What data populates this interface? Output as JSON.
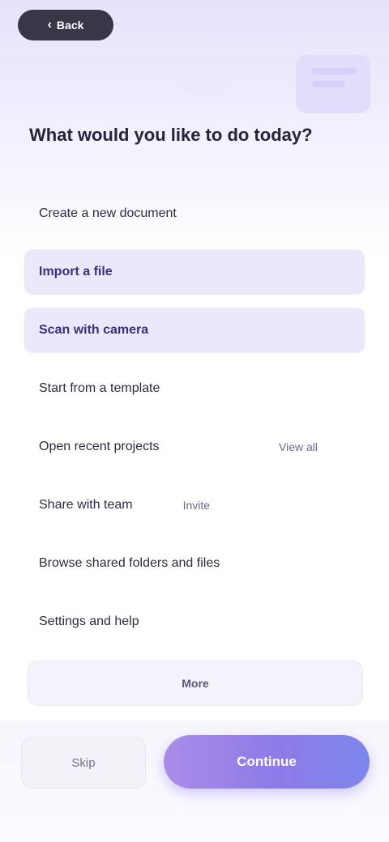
{
  "header": {
    "back_label": "Back",
    "back_icon": "chevron-left-icon"
  },
  "intro": {
    "headline": "What would you like to do today?"
  },
  "menu": [
    {
      "label": "Create a new document",
      "highlighted": false,
      "tail": ""
    },
    {
      "label": "Import a file",
      "highlighted": true,
      "tail": ""
    },
    {
      "label": "Scan with camera",
      "highlighted": true,
      "tail": ""
    },
    {
      "label": "Start from a template",
      "highlighted": false,
      "tail": ""
    },
    {
      "label": "Open recent projects",
      "highlighted": false,
      "tail": "View all"
    },
    {
      "label": "Share with team",
      "highlighted": false,
      "tail": "Invite"
    },
    {
      "label": "Browse shared folders and files",
      "highlighted": false,
      "tail": ""
    },
    {
      "label": "Settings and help",
      "highlighted": false,
      "tail": ""
    }
  ],
  "info": {
    "text": "More"
  },
  "footer": {
    "secondary_label": "Skip",
    "primary_label": "Continue"
  },
  "colors": {
    "accent_start": "#a98de8",
    "accent_end": "#7d86ea",
    "highlight_bg": "#ece8fb",
    "dark": "#3a3547"
  }
}
